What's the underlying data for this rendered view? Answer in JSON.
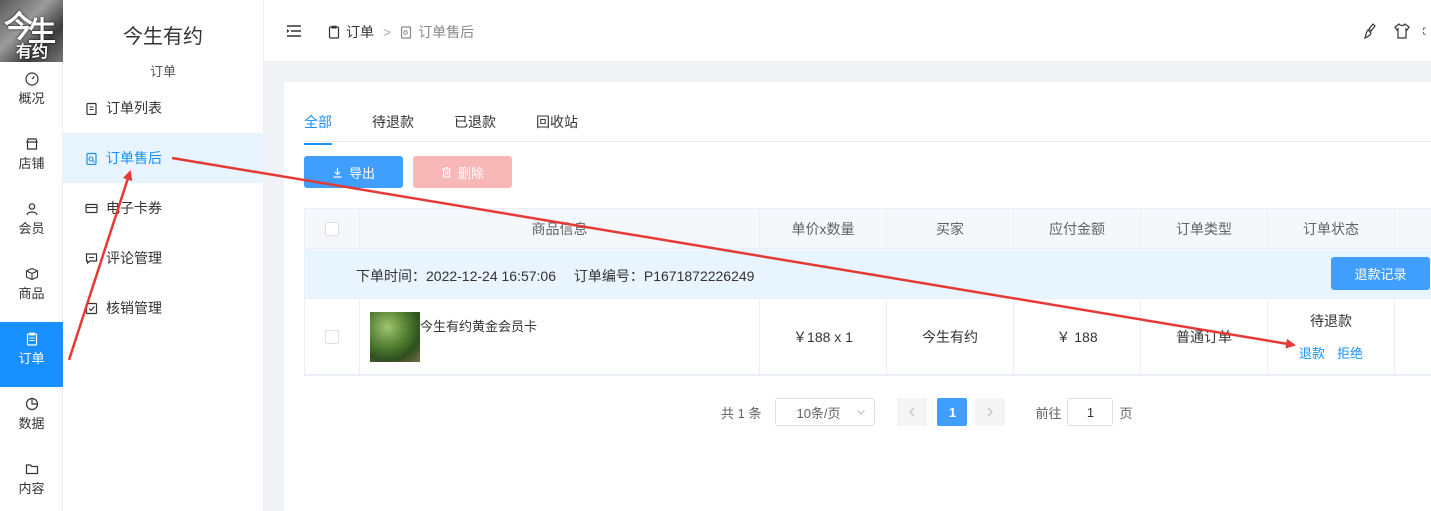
{
  "logo": {
    "chars": [
      "今",
      "生",
      "有约"
    ]
  },
  "rail": [
    {
      "label": "概况",
      "icon": "dashboard-icon"
    },
    {
      "label": "店铺",
      "icon": "store-icon"
    },
    {
      "label": "会员",
      "icon": "user-icon"
    },
    {
      "label": "商品",
      "icon": "box-icon"
    },
    {
      "label": "订单",
      "icon": "clipboard-icon",
      "active": true
    },
    {
      "label": "数据",
      "icon": "pie-icon"
    },
    {
      "label": "内容",
      "icon": "folder-icon"
    }
  ],
  "sidebar": {
    "brand": "今生有约",
    "group": "订单",
    "items": [
      {
        "label": "订单列表",
        "icon": "clipboard-icon"
      },
      {
        "label": "订单售后",
        "icon": "clipboard-search-icon",
        "active": true
      },
      {
        "label": "电子卡券",
        "icon": "card-icon"
      },
      {
        "label": "评论管理",
        "icon": "comment-icon"
      },
      {
        "label": "核销管理",
        "icon": "check-square-icon"
      }
    ]
  },
  "header": {
    "breadcrumb": [
      "订单",
      "订单售后"
    ],
    "separator": ">"
  },
  "tabs": [
    "全部",
    "待退款",
    "已退款",
    "回收站"
  ],
  "actions": {
    "export": "导出",
    "delete": "删除"
  },
  "table": {
    "columns": [
      "",
      "商品信息",
      "单价x数量",
      "买家",
      "应付金额",
      "订单类型",
      "订单状态",
      ""
    ],
    "order": {
      "time_label": "下单时间：",
      "time": "2022-12-24 16:57:06",
      "no_label": "订单编号：",
      "no": "P1671872226249",
      "refund_log": "退款记录"
    },
    "row": {
      "product": "今生有约黄金会员卡",
      "price_qty": "￥188 x 1",
      "buyer": "今生有约",
      "amount": "￥ 188",
      "type": "普通订单",
      "status": "待退款",
      "refund": "退款",
      "reject": "拒绝"
    }
  },
  "pager": {
    "total": "共 1 条",
    "size": "10条/页",
    "current": "1",
    "goto_label": "前往",
    "goto_value": "1",
    "page_unit": "页"
  },
  "colors": {
    "accent": "#1890ff",
    "button": "#409eff",
    "delete_disabled": "#f9b8b8",
    "arrow": "#e53935"
  }
}
